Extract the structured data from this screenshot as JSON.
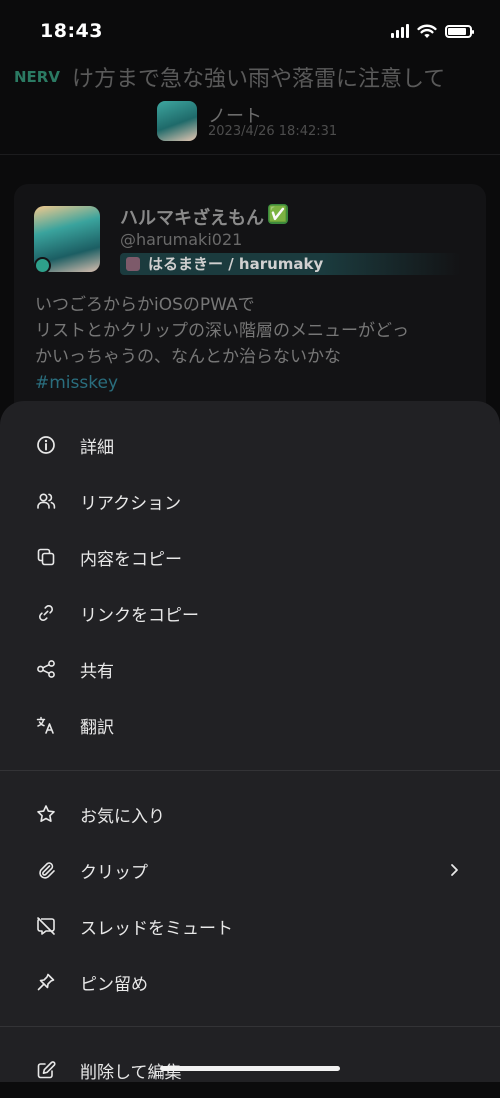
{
  "status_bar": {
    "time": "18:43"
  },
  "ticker": {
    "source": "NERV",
    "text": "け方まで急な強い雨や落雷に注意して"
  },
  "header": {
    "title": "ノート",
    "timestamp": "2023/4/26 18:42:31"
  },
  "note": {
    "display_name": "ハルマキざえもん",
    "verified_emoji": "✅",
    "username": "@harumaki021",
    "instance_name": "はるまきー / harumaky",
    "text_lines": [
      "いつごろからかiOSのPWAで",
      "リストとかクリップの深い階層のメニューがどっ",
      "かいっちゃうの、なんとか治らないかな"
    ],
    "hashtag": "#misskey"
  },
  "menu": {
    "group1": [
      {
        "label": "詳細",
        "icon": "info-icon"
      },
      {
        "label": "リアクション",
        "icon": "users-icon"
      },
      {
        "label": "内容をコピー",
        "icon": "copy-icon"
      },
      {
        "label": "リンクをコピー",
        "icon": "link-icon"
      },
      {
        "label": "共有",
        "icon": "share-icon"
      },
      {
        "label": "翻訳",
        "icon": "translate-icon"
      }
    ],
    "group2": [
      {
        "label": "お気に入り",
        "icon": "star-icon"
      },
      {
        "label": "クリップ",
        "icon": "paperclip-icon"
      },
      {
        "label": "スレッドをミュート",
        "icon": "message-off-icon"
      },
      {
        "label": "ピン留め",
        "icon": "pin-icon"
      }
    ],
    "group3": [
      {
        "label": "削除して編集",
        "icon": "edit-icon"
      }
    ]
  },
  "colors": {
    "sheet_bg": "#212124",
    "accent": "#2ea08a",
    "hashtag": "#2a6e7e"
  }
}
